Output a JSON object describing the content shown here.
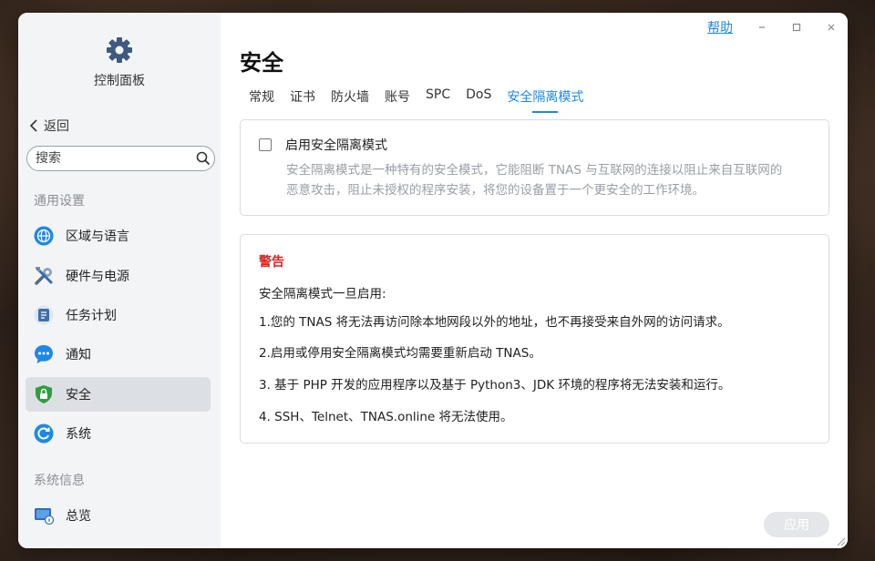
{
  "app": {
    "title": "控制面板"
  },
  "sidebar": {
    "back_label": "返回",
    "search_placeholder": "搜索",
    "section_general": "通用设置",
    "section_info": "系统信息",
    "items": [
      {
        "label": "区域与语言",
        "icon": "globe-icon"
      },
      {
        "label": "硬件与电源",
        "icon": "tools-icon"
      },
      {
        "label": "任务计划",
        "icon": "task-list-icon"
      },
      {
        "label": "通知",
        "icon": "chat-bubble-icon"
      },
      {
        "label": "安全",
        "icon": "shield-lock-icon",
        "active": true
      },
      {
        "label": "系统",
        "icon": "refresh-icon"
      },
      {
        "label": "总览",
        "icon": "monitor-info-icon"
      }
    ]
  },
  "header": {
    "help": "帮助",
    "title": "安全"
  },
  "tabs": [
    {
      "label": "常规"
    },
    {
      "label": "证书"
    },
    {
      "label": "防火墙"
    },
    {
      "label": "账号"
    },
    {
      "label": "SPC"
    },
    {
      "label": "DoS"
    },
    {
      "label": "安全隔离模式",
      "active": true
    }
  ],
  "isolation": {
    "checkbox_label": "启用安全隔离模式",
    "checked": false,
    "desc_line1": "安全隔离模式是一种特有的安全模式，它能阻断 TNAS 与互联网的连接以阻止来自互联网的",
    "desc_line2": "恶意攻击，阻止未授权的程序安装，将您的设备置于一个更安全的工作环境。"
  },
  "warning": {
    "title": "警告",
    "intro": "安全隔离模式一旦启用:",
    "lines": [
      "1.您的 TNAS 将无法再访问除本地网段以外的地址，也不再接受来自外网的访问请求。",
      "2.启用或停用安全隔离模式均需要重新启动 TNAS。",
      "3. 基于 PHP 开发的应用程序以及基于 Python3、JDK 环境的程序将无法安装和运行。",
      "4. SSH、Telnet、TNAS.online 将无法使用。"
    ]
  },
  "footer": {
    "apply_label": "应用"
  },
  "colors": {
    "accent": "#1e88e5",
    "warning": "#e02020"
  }
}
